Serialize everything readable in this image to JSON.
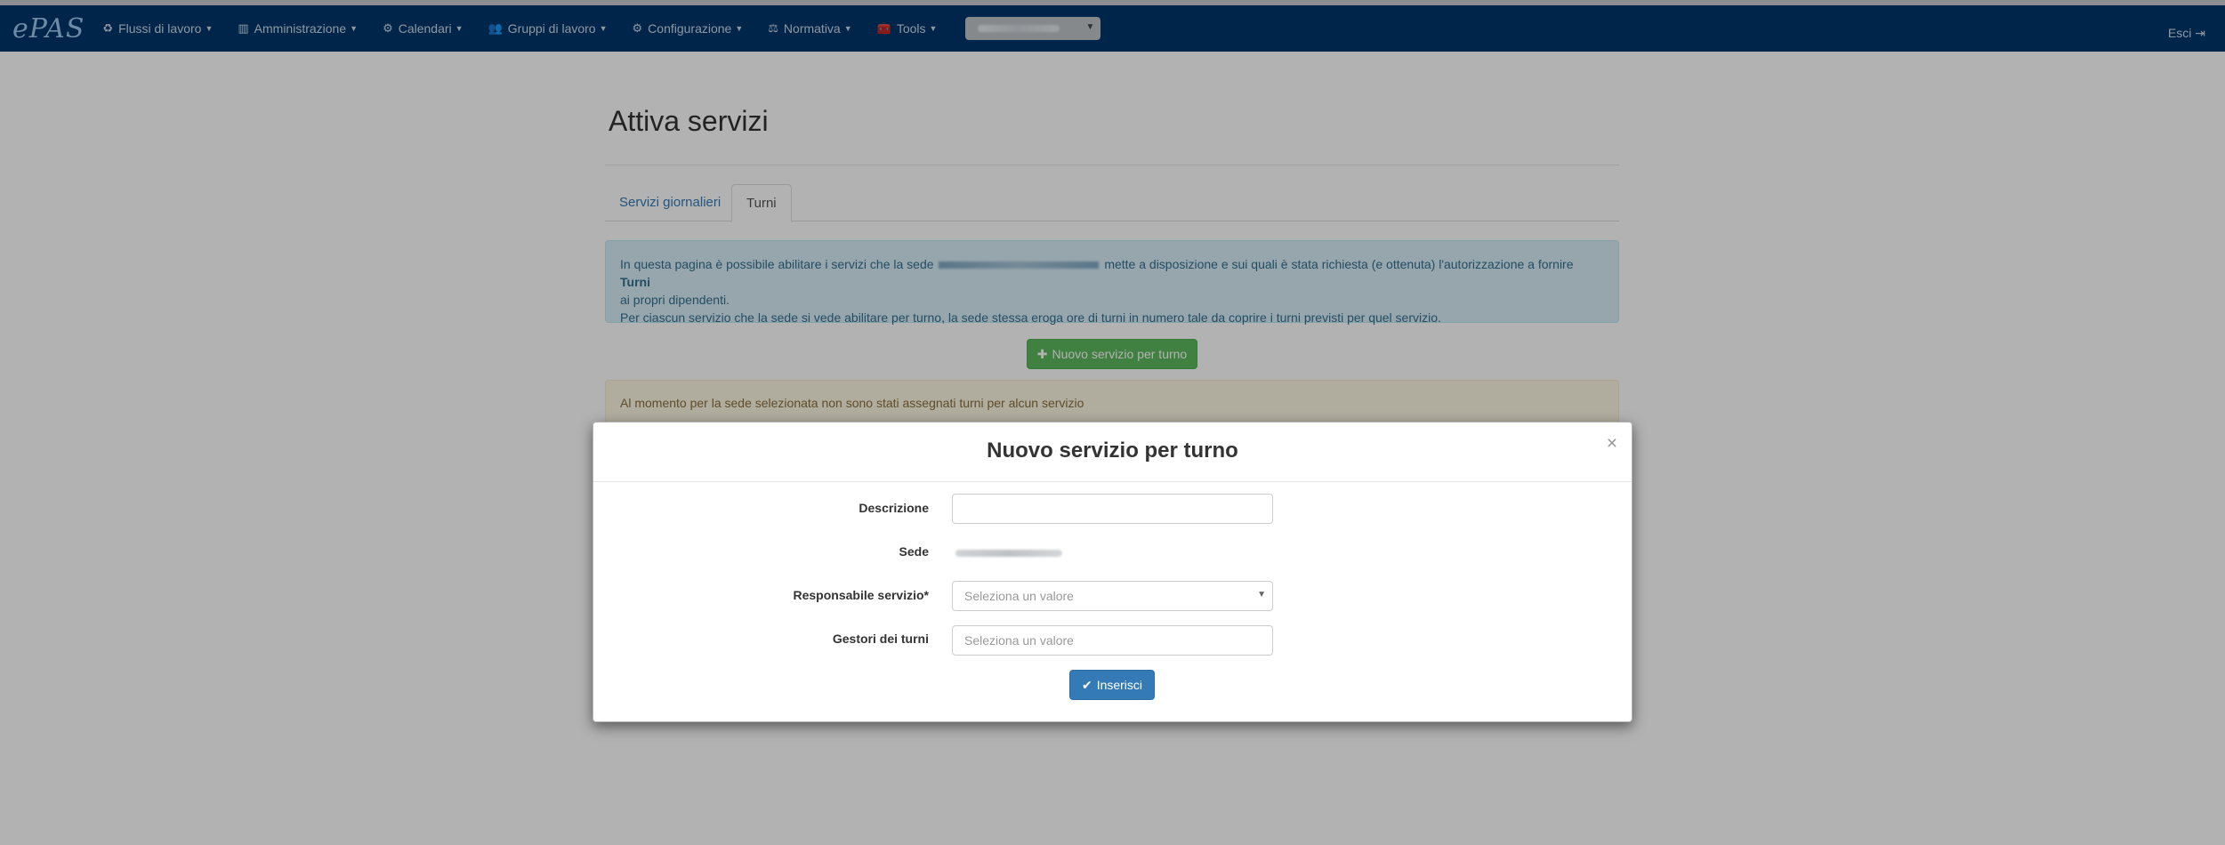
{
  "navbar": {
    "brand": "ePAS",
    "menus": [
      {
        "icon": "♻",
        "label": "Flussi di lavoro"
      },
      {
        "icon": "▥",
        "label": "Amministrazione"
      },
      {
        "icon": "⚙",
        "label": "Calendari"
      },
      {
        "icon": "👥",
        "label": "Gruppi di lavoro"
      },
      {
        "icon": "⚙",
        "label": "Configurazione"
      },
      {
        "icon": "⚖",
        "label": "Normativa"
      },
      {
        "icon": "🧰",
        "label": "Tools"
      }
    ],
    "logout": "Esci ⇥"
  },
  "page": {
    "title": "Attiva servizi",
    "tabs": [
      {
        "label": "Servizi giornalieri"
      },
      {
        "label": "Turni"
      }
    ],
    "info": {
      "part1": "In questa pagina è possibile abilitare i servizi che la sede",
      "part2": "mette a disposizione e sui quali è stata richiesta (e ottenuta) l'autorizzazione a fornire",
      "bold": "Turni",
      "part3": "ai propri dipendenti.",
      "line2": "Per ciascun servizio che la sede si vede abilitare per turno, la sede stessa eroga ore di turni in numero tale da coprire i turni previsti per quel servizio."
    },
    "new_button": "Nuovo servizio per turno",
    "warning": "Al momento per la sede selezionata non sono stati assegnati turni per alcun servizio"
  },
  "modal": {
    "title": "Nuovo servizio per turno",
    "close": "×",
    "fields": {
      "descrizione_label": "Descrizione",
      "sede_label": "Sede",
      "responsabile_label": "Responsabile servizio*",
      "responsabile_placeholder": "Seleziona un valore",
      "gestori_label": "Gestori dei turni",
      "gestori_placeholder": "Seleziona un valore"
    },
    "submit": "Inserisci"
  },
  "colors": {
    "navbar": "#01366b",
    "primary": "#337ab7",
    "success": "#5cb85c"
  }
}
